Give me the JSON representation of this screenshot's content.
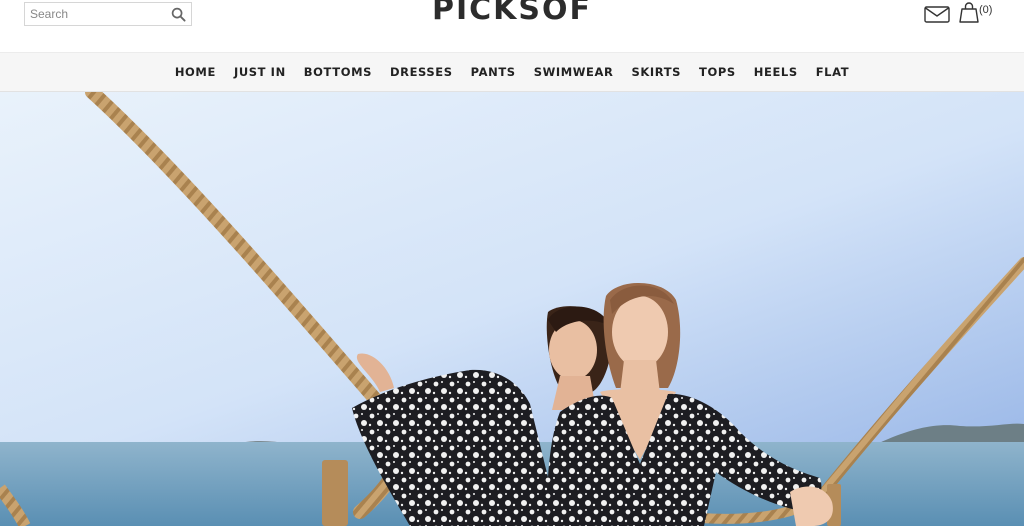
{
  "header": {
    "search": {
      "placeholder": "Search",
      "value": ""
    },
    "logo": "PICKSOF",
    "cart_count": "(0)"
  },
  "nav": {
    "items": [
      "HOME",
      "JUST IN",
      "BOTTOMS",
      "DRESSES",
      "PANTS",
      "SWIMWEAR",
      "SKIRTS",
      "TOPS",
      "HEELS",
      "FLAT"
    ]
  },
  "icons": {
    "search": "search-icon",
    "mail": "mail-icon",
    "cart": "shopping-bag-icon"
  },
  "colors": {
    "text_dark": "#2c2c2c",
    "nav_bg": "#f6f6f6",
    "sky_top": "#9fbce8",
    "sea": "#5f93b7",
    "rope": "#c19a65",
    "dress": "#1d1d22"
  }
}
